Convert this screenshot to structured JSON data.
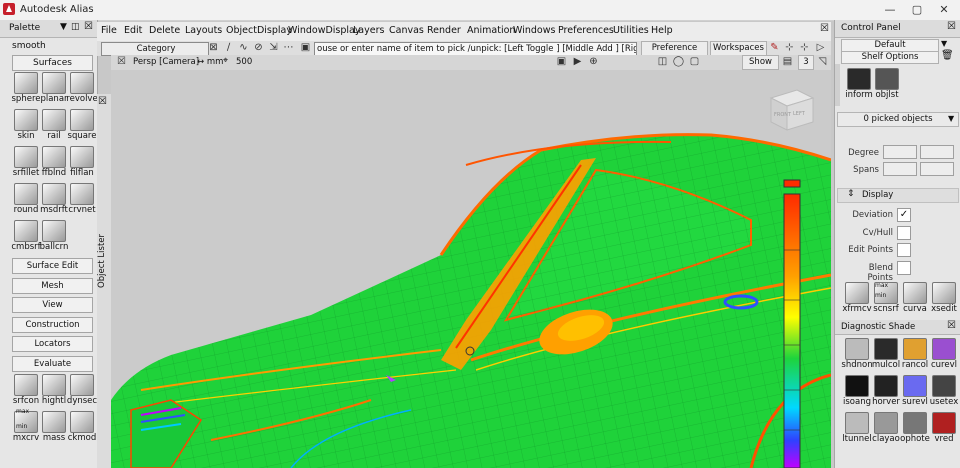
{
  "app": {
    "title": "Autodesk Alias"
  },
  "window_controls": {
    "minimize": "—",
    "maximize": "▢",
    "close": "✕"
  },
  "menubar": {
    "items": [
      "File",
      "Edit",
      "Delete",
      "Layouts",
      "ObjectDisplay",
      "WindowDisplay",
      "Layers",
      "Canvas",
      "Render",
      "Animation",
      "Windows",
      "Preferences",
      "Utilities",
      "Help"
    ]
  },
  "palette": {
    "title": "Palette",
    "top_label": "smooth",
    "surfaces_tab": "Surfaces",
    "surface_tools": [
      "sphere",
      "planar",
      "revolve",
      "skin",
      "rail",
      "square",
      "srfillet",
      "ffblnd",
      "filflan",
      "round",
      "msdrft",
      "crvnet",
      "cmbsrf",
      "ballcrn"
    ],
    "sections": [
      "Surface Edit",
      "Mesh",
      "View",
      "Construction",
      "Locators",
      "Evaluate"
    ],
    "evaluate_tools": [
      "srfcon",
      "hightl",
      "dynsec",
      "mxcrv",
      "mass",
      "ckmod"
    ],
    "evaluate_sublabels": {
      "max": "max",
      "min": "min"
    }
  },
  "object_lister": {
    "label": "Object Lister"
  },
  "toolbar": {
    "category": "Category",
    "prompt": "ouse or enter name of item to pick /unpick: [Left Toggle ] [Middle Add ] [Right Unpick ]",
    "preference_sets": "Preference Sets",
    "workspaces": "Workspaces"
  },
  "viewport": {
    "camera_label": "Persp [Camera]",
    "units": "↔ mm",
    "grid_value": "500",
    "show_button": "Show",
    "page_number": "3",
    "viewcube_faces": {
      "front": "FRONT",
      "left": "LEFT"
    }
  },
  "control_panel": {
    "title": "Control Panel",
    "layout_select": "Default",
    "shelf_options": "Shelf Options",
    "shelf_tools": [
      "inform",
      "objlst"
    ],
    "picked_objects": "0 picked objects",
    "degree_label": "Degree",
    "spans_label": "Spans",
    "display_section": "Display",
    "options": [
      {
        "label": "Deviation",
        "checked": true
      },
      {
        "label": "Cv/Hull",
        "checked": false
      },
      {
        "label": "Edit Points",
        "checked": false
      },
      {
        "label": "Blend Points",
        "checked": false
      }
    ],
    "shelf_row2": [
      "xfrmcv",
      "scnsrf",
      "curva",
      "xsedit"
    ],
    "shelf_row2_sublabels": {
      "max": "max",
      "min": "min"
    }
  },
  "diagnostic_shade": {
    "title": "Diagnostic Shade",
    "tools": [
      "shdnon",
      "mulcol",
      "rancol",
      "curevl",
      "isoang",
      "horver",
      "surevl",
      "usetex",
      "ltunnel",
      "clayao",
      "ophote",
      "vred"
    ]
  },
  "colors": {
    "accent": "#c61f2b",
    "curvature_green": "#1fd23a",
    "highlight_orange": "#ff8a00"
  }
}
